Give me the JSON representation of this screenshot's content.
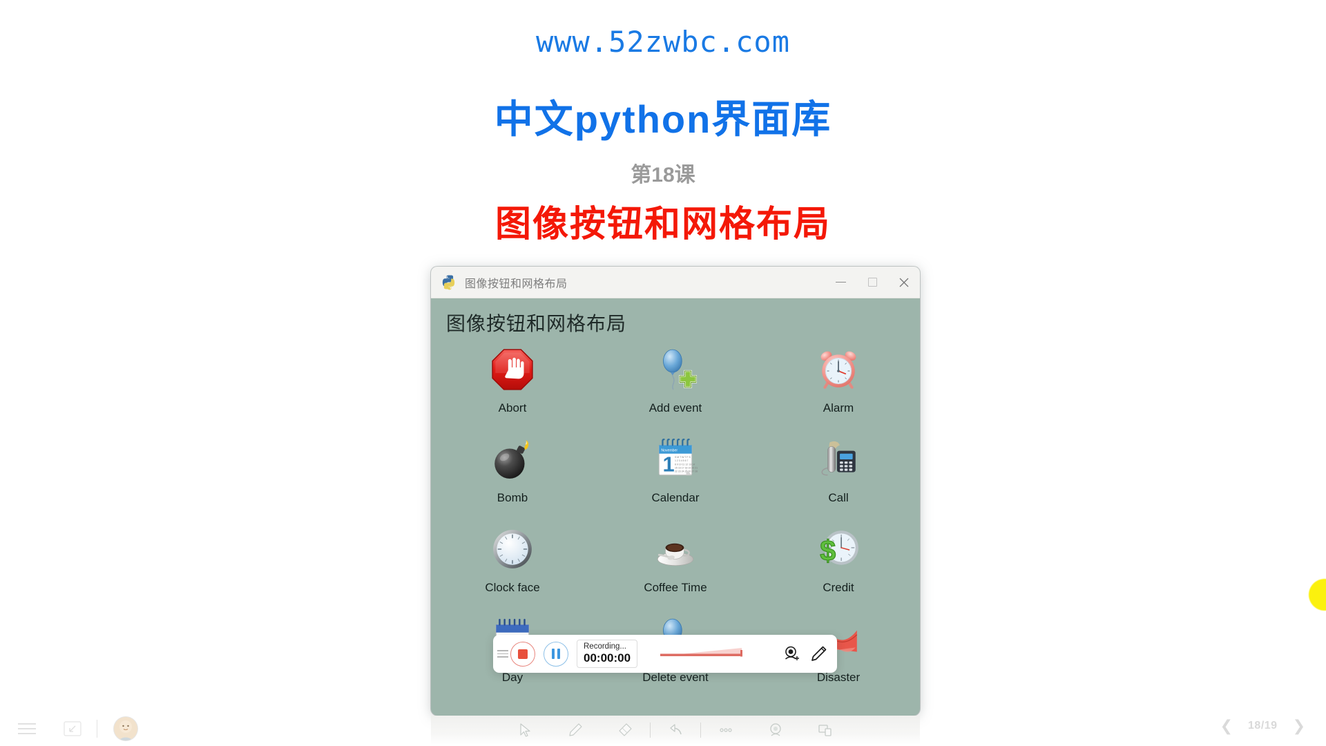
{
  "slide": {
    "site_url": "www.52zwbc.com",
    "main_title": "中文python界面库",
    "lesson_number": "第18课",
    "lesson_title": "图像按钮和网格布局",
    "colors": {
      "url": "#1a7ae4",
      "main_title": "#1172e8",
      "lesson_number": "#9a9a9a",
      "lesson_title": "#f41807",
      "app_background": "#9db5ab"
    }
  },
  "app_window": {
    "title": "图像按钮和网格布局",
    "app_icon": "python-logo-icon",
    "heading": "图像按钮和网格布局",
    "controls": {
      "minimize": "minimize-icon",
      "maximize": "maximize-icon",
      "close": "close-icon"
    },
    "grid": {
      "columns": 3,
      "items": [
        {
          "label": "Abort",
          "icon": "stop-hand-octagon-icon"
        },
        {
          "label": "Add event",
          "icon": "balloon-plus-icon"
        },
        {
          "label": "Alarm",
          "icon": "alarm-clock-icon"
        },
        {
          "label": "Bomb",
          "icon": "bomb-icon"
        },
        {
          "label": "Calendar",
          "icon": "calendar-icon"
        },
        {
          "label": "Call",
          "icon": "desk-phone-icon"
        },
        {
          "label": "Clock face",
          "icon": "clock-face-icon"
        },
        {
          "label": "Coffee Time",
          "icon": "coffee-cup-icon"
        },
        {
          "label": "Credit",
          "icon": "dollar-clock-icon"
        },
        {
          "label": "Day",
          "icon": "day-calendar-icon"
        },
        {
          "label": "Delete event",
          "icon": "balloon-minus-icon"
        },
        {
          "label": "Disaster",
          "icon": "disaster-icon"
        }
      ]
    }
  },
  "recorder_toolbar": {
    "drag_handle": "drag-handle-icon",
    "stop_button": "stop-record-icon",
    "pause_button": "pause-record-icon",
    "status_label": "Recording...",
    "elapsed_time": "00:00:00",
    "audio_meter": "audio-level-meter",
    "webcam_button": "webcam-add-icon",
    "draw_button": "pencil-icon"
  },
  "annotation_toolbar": {
    "buttons": [
      {
        "name": "cursor-tool",
        "icon": "cursor-arrow-icon"
      },
      {
        "name": "pen-tool",
        "icon": "pencil-icon"
      },
      {
        "name": "eraser-tool",
        "icon": "eraser-icon"
      },
      {
        "name": "undo-tool",
        "icon": "undo-arrow-icon"
      },
      {
        "name": "more-tool",
        "icon": "ellipsis-icon"
      },
      {
        "name": "spotlight-tool",
        "icon": "spotlight-icon"
      },
      {
        "name": "screen-tool",
        "icon": "screen-share-icon"
      }
    ]
  },
  "bottom_bar": {
    "menu_button": "hamburger-menu-icon",
    "collapse_button": "collapse-icon",
    "avatar": "user-avatar",
    "prev_button": "chevron-left-icon",
    "next_button": "chevron-right-icon",
    "page_indicator": "18/19"
  },
  "overlay": {
    "laser_dot": "laser-pointer-dot"
  }
}
